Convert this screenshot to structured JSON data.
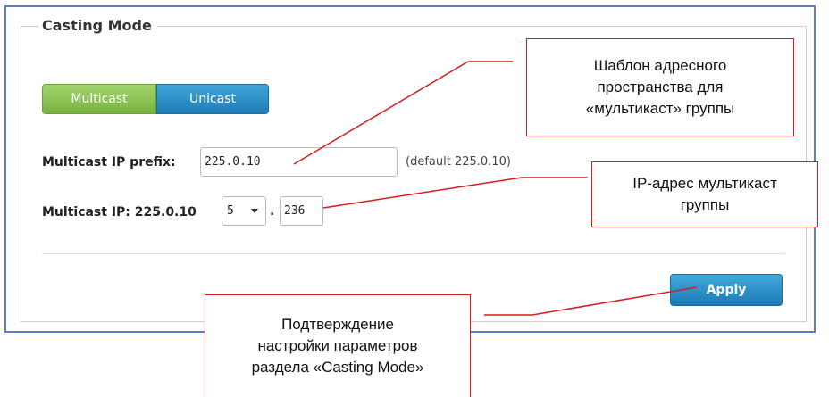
{
  "panel": {
    "title": "Casting Mode"
  },
  "toggle": {
    "multicast_label": "Multicast",
    "unicast_label": "Unicast",
    "active": "Multicast"
  },
  "prefix": {
    "label": "Multicast IP prefix:",
    "value": "225.0.10",
    "hint": "(default 225.0.10)"
  },
  "multicast_ip": {
    "label": "Multicast IP: 225.0.10",
    "octet3_selected": "5",
    "separator": ".",
    "octet4_value": "236"
  },
  "apply_label": "Apply",
  "annotations": {
    "prefix_note": [
      "Шаблон адресного",
      "пространства для",
      "«мультикаст» группы"
    ],
    "ip_note": [
      "IP-адрес мультикаст",
      "группы"
    ],
    "apply_note": [
      "Подтверждение",
      "настройки параметров",
      "раздела «Casting Mode»"
    ]
  },
  "colors": {
    "frame": "#5b7fc0",
    "multicast_button": "#79b43f",
    "unicast_button": "#1f7db7",
    "apply_button": "#1d7cb6",
    "annotation": "#d11e1e"
  }
}
